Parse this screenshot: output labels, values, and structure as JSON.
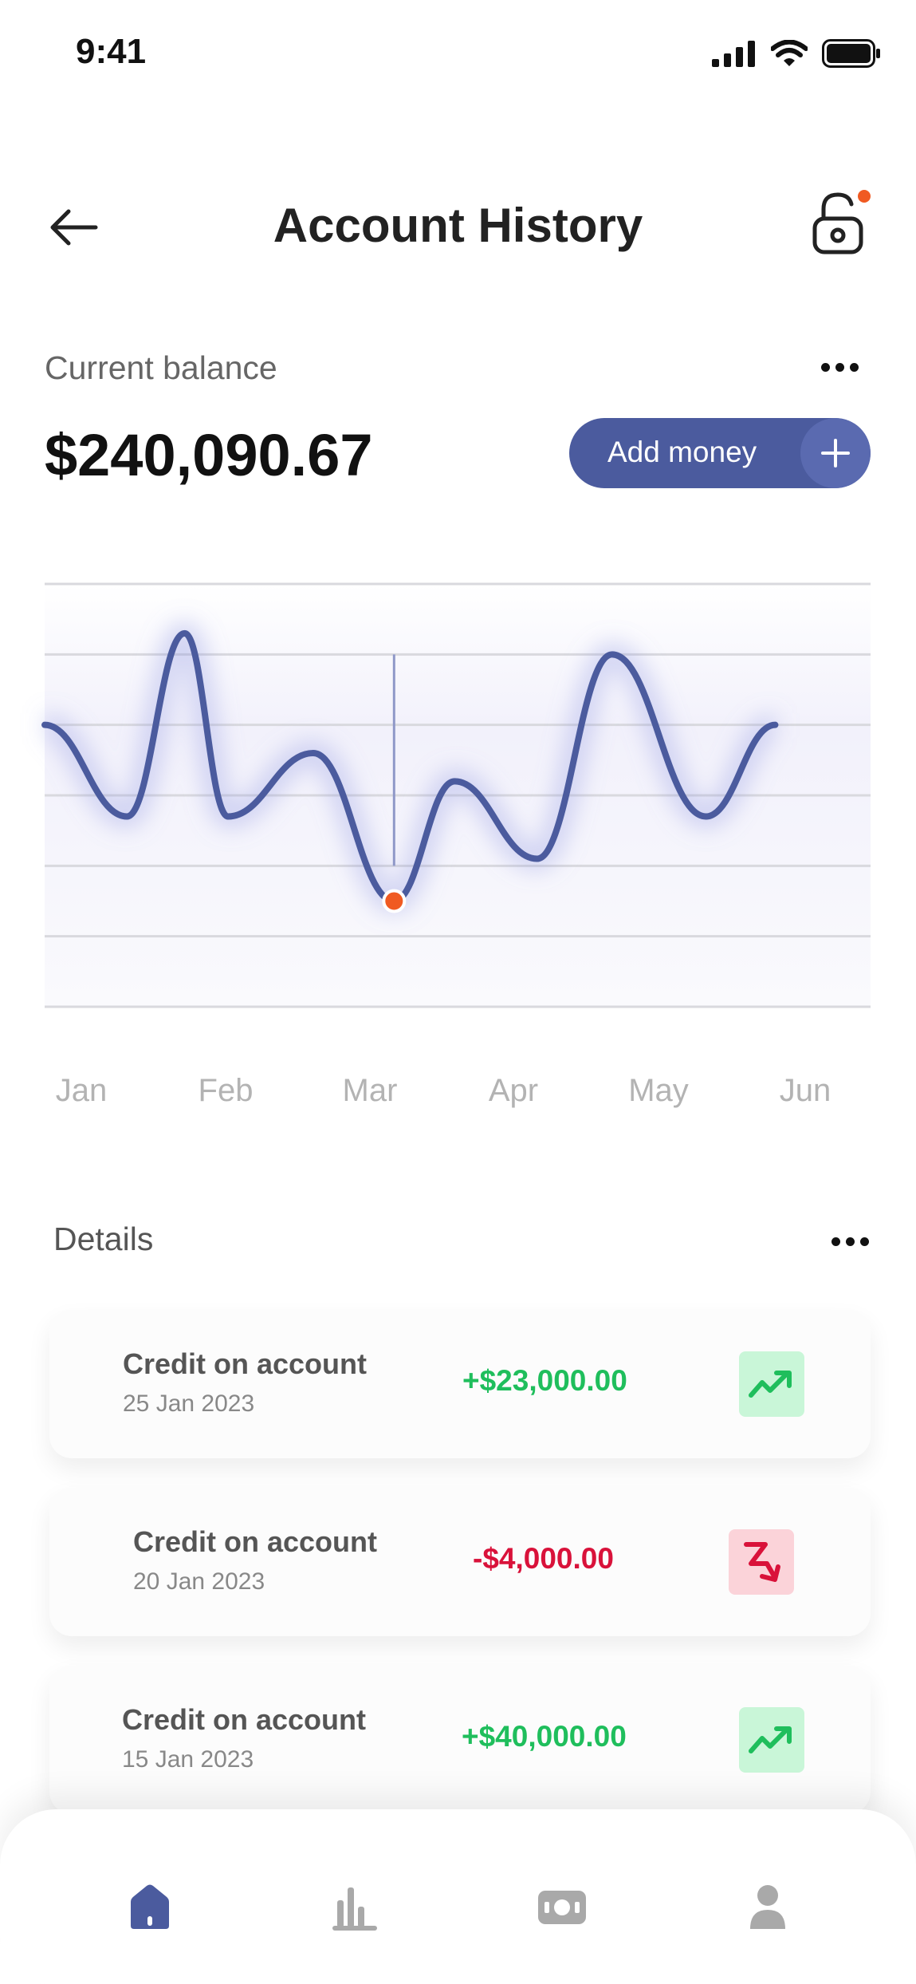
{
  "status_bar": {
    "time": "9:41"
  },
  "header": {
    "title": "Account History"
  },
  "balance": {
    "label": "Current balance",
    "amount": "$240,090.67",
    "add_money_label": "Add money"
  },
  "chart_data": {
    "type": "line",
    "categories": [
      "Jan",
      "Feb",
      "Mar",
      "Apr",
      "May",
      "Jun"
    ],
    "x": [
      0.0,
      0.57,
      0.97,
      1.27,
      1.86,
      2.42,
      2.84,
      3.41,
      3.93,
      4.58,
      5.06,
      5.72
    ],
    "y": [
      4,
      2.7,
      5.3,
      2.7,
      3.6,
      1.5,
      3.2,
      2.1,
      5,
      2.7,
      4
    ],
    "marker": {
      "x": 2.42,
      "color": "#f05a22"
    },
    "line_color": "#4b5b9e",
    "grid": true,
    "ylim": [
      0,
      6
    ]
  },
  "details": {
    "title": "Details",
    "transactions": [
      {
        "title": "Credit on account",
        "date": "25 Jan 2023",
        "amount": "+$23,000.00",
        "direction": "up"
      },
      {
        "title": "Credit on account",
        "date": "20 Jan 2023",
        "amount": "-$4,000.00",
        "direction": "down"
      },
      {
        "title": "Credit on account",
        "date": "15 Jan 2023",
        "amount": "+$40,000.00",
        "direction": "up"
      }
    ]
  },
  "bottom_nav": {
    "items": [
      {
        "icon": "home-icon",
        "active": true
      },
      {
        "icon": "bar-chart-icon",
        "active": false
      },
      {
        "icon": "money-icon",
        "active": false
      },
      {
        "icon": "profile-icon",
        "active": false
      }
    ]
  },
  "colors": {
    "accent": "#4b5b9e",
    "notification": "#f05a22",
    "positive": "#1fbe5c",
    "negative": "#d9123a"
  }
}
